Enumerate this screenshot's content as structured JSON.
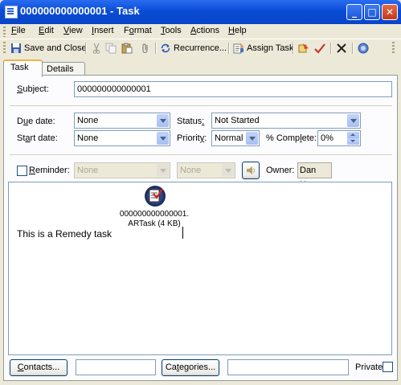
{
  "window": {
    "title": "000000000000001 - Task",
    "controls": {
      "minimize": "_",
      "maximize": "□",
      "close": "✕"
    }
  },
  "menu": {
    "items": [
      {
        "pre": "",
        "ul": "F",
        "post": "ile"
      },
      {
        "pre": "",
        "ul": "E",
        "post": "dit"
      },
      {
        "pre": "",
        "ul": "V",
        "post": "iew"
      },
      {
        "pre": "",
        "ul": "I",
        "post": "nsert"
      },
      {
        "pre": "F",
        "ul": "o",
        "post": "rmat"
      },
      {
        "pre": "",
        "ul": "T",
        "post": "ools"
      },
      {
        "pre": "",
        "ul": "A",
        "post": "ctions"
      },
      {
        "pre": "",
        "ul": "H",
        "post": "elp"
      }
    ]
  },
  "toolbar": {
    "save_close": {
      "ul": "S",
      "post": "ave and Close"
    },
    "recurrence": {
      "pre": "Re",
      "ul": "c",
      "post": "urrence..."
    },
    "assign_task": {
      "pre": "Assig",
      "ul": "n",
      "post": " Task"
    }
  },
  "tabs": [
    "Task",
    "Details"
  ],
  "form": {
    "subject_label": {
      "ul": "S",
      "post": "ubject:"
    },
    "subject_value": "000000000000001",
    "due_date_label": {
      "pre": "D",
      "ul": "u",
      "post": "e date:"
    },
    "due_date_value": "None",
    "start_date_label": {
      "pre": "St",
      "ul": "a",
      "post": "rt date:"
    },
    "start_date_value": "None",
    "status_label": {
      "pre": "Status",
      "ul": ":",
      "post": ""
    },
    "status_value": "Not Started",
    "priority_label": {
      "pre": "Priorit",
      "ul": "y",
      "post": ":"
    },
    "priority_value": "Normal",
    "complete_label": {
      "pre": "% Comp",
      "ul": "l",
      "post": "ete:"
    },
    "complete_value": "0%",
    "reminder_label": {
      "pre": "",
      "ul": "R",
      "post": "eminder:"
    },
    "reminder_date": "None",
    "reminder_time": "None",
    "owner_label": "Owner:",
    "owner_value": "Dan Har"
  },
  "attachment": {
    "name_line1": "000000000000001.",
    "name_line2": "ARTask (4 KB)"
  },
  "body_text": "This is a Remedy task",
  "footer": {
    "contacts": {
      "ul": "C",
      "post": "ontacts..."
    },
    "categories": {
      "pre": "Ca",
      "ul": "t",
      "post": "egories..."
    },
    "private_label": "Private"
  },
  "icons": [
    "app-icon",
    "save-icon",
    "cut-icon",
    "copy-icon",
    "paste-icon",
    "attach-icon",
    "recurrence-icon",
    "assign-task-icon",
    "send-status-icon",
    "mark-complete-icon",
    "delete-icon",
    "help-icon",
    "reminder-sound-icon",
    "remedy-task-icon"
  ]
}
